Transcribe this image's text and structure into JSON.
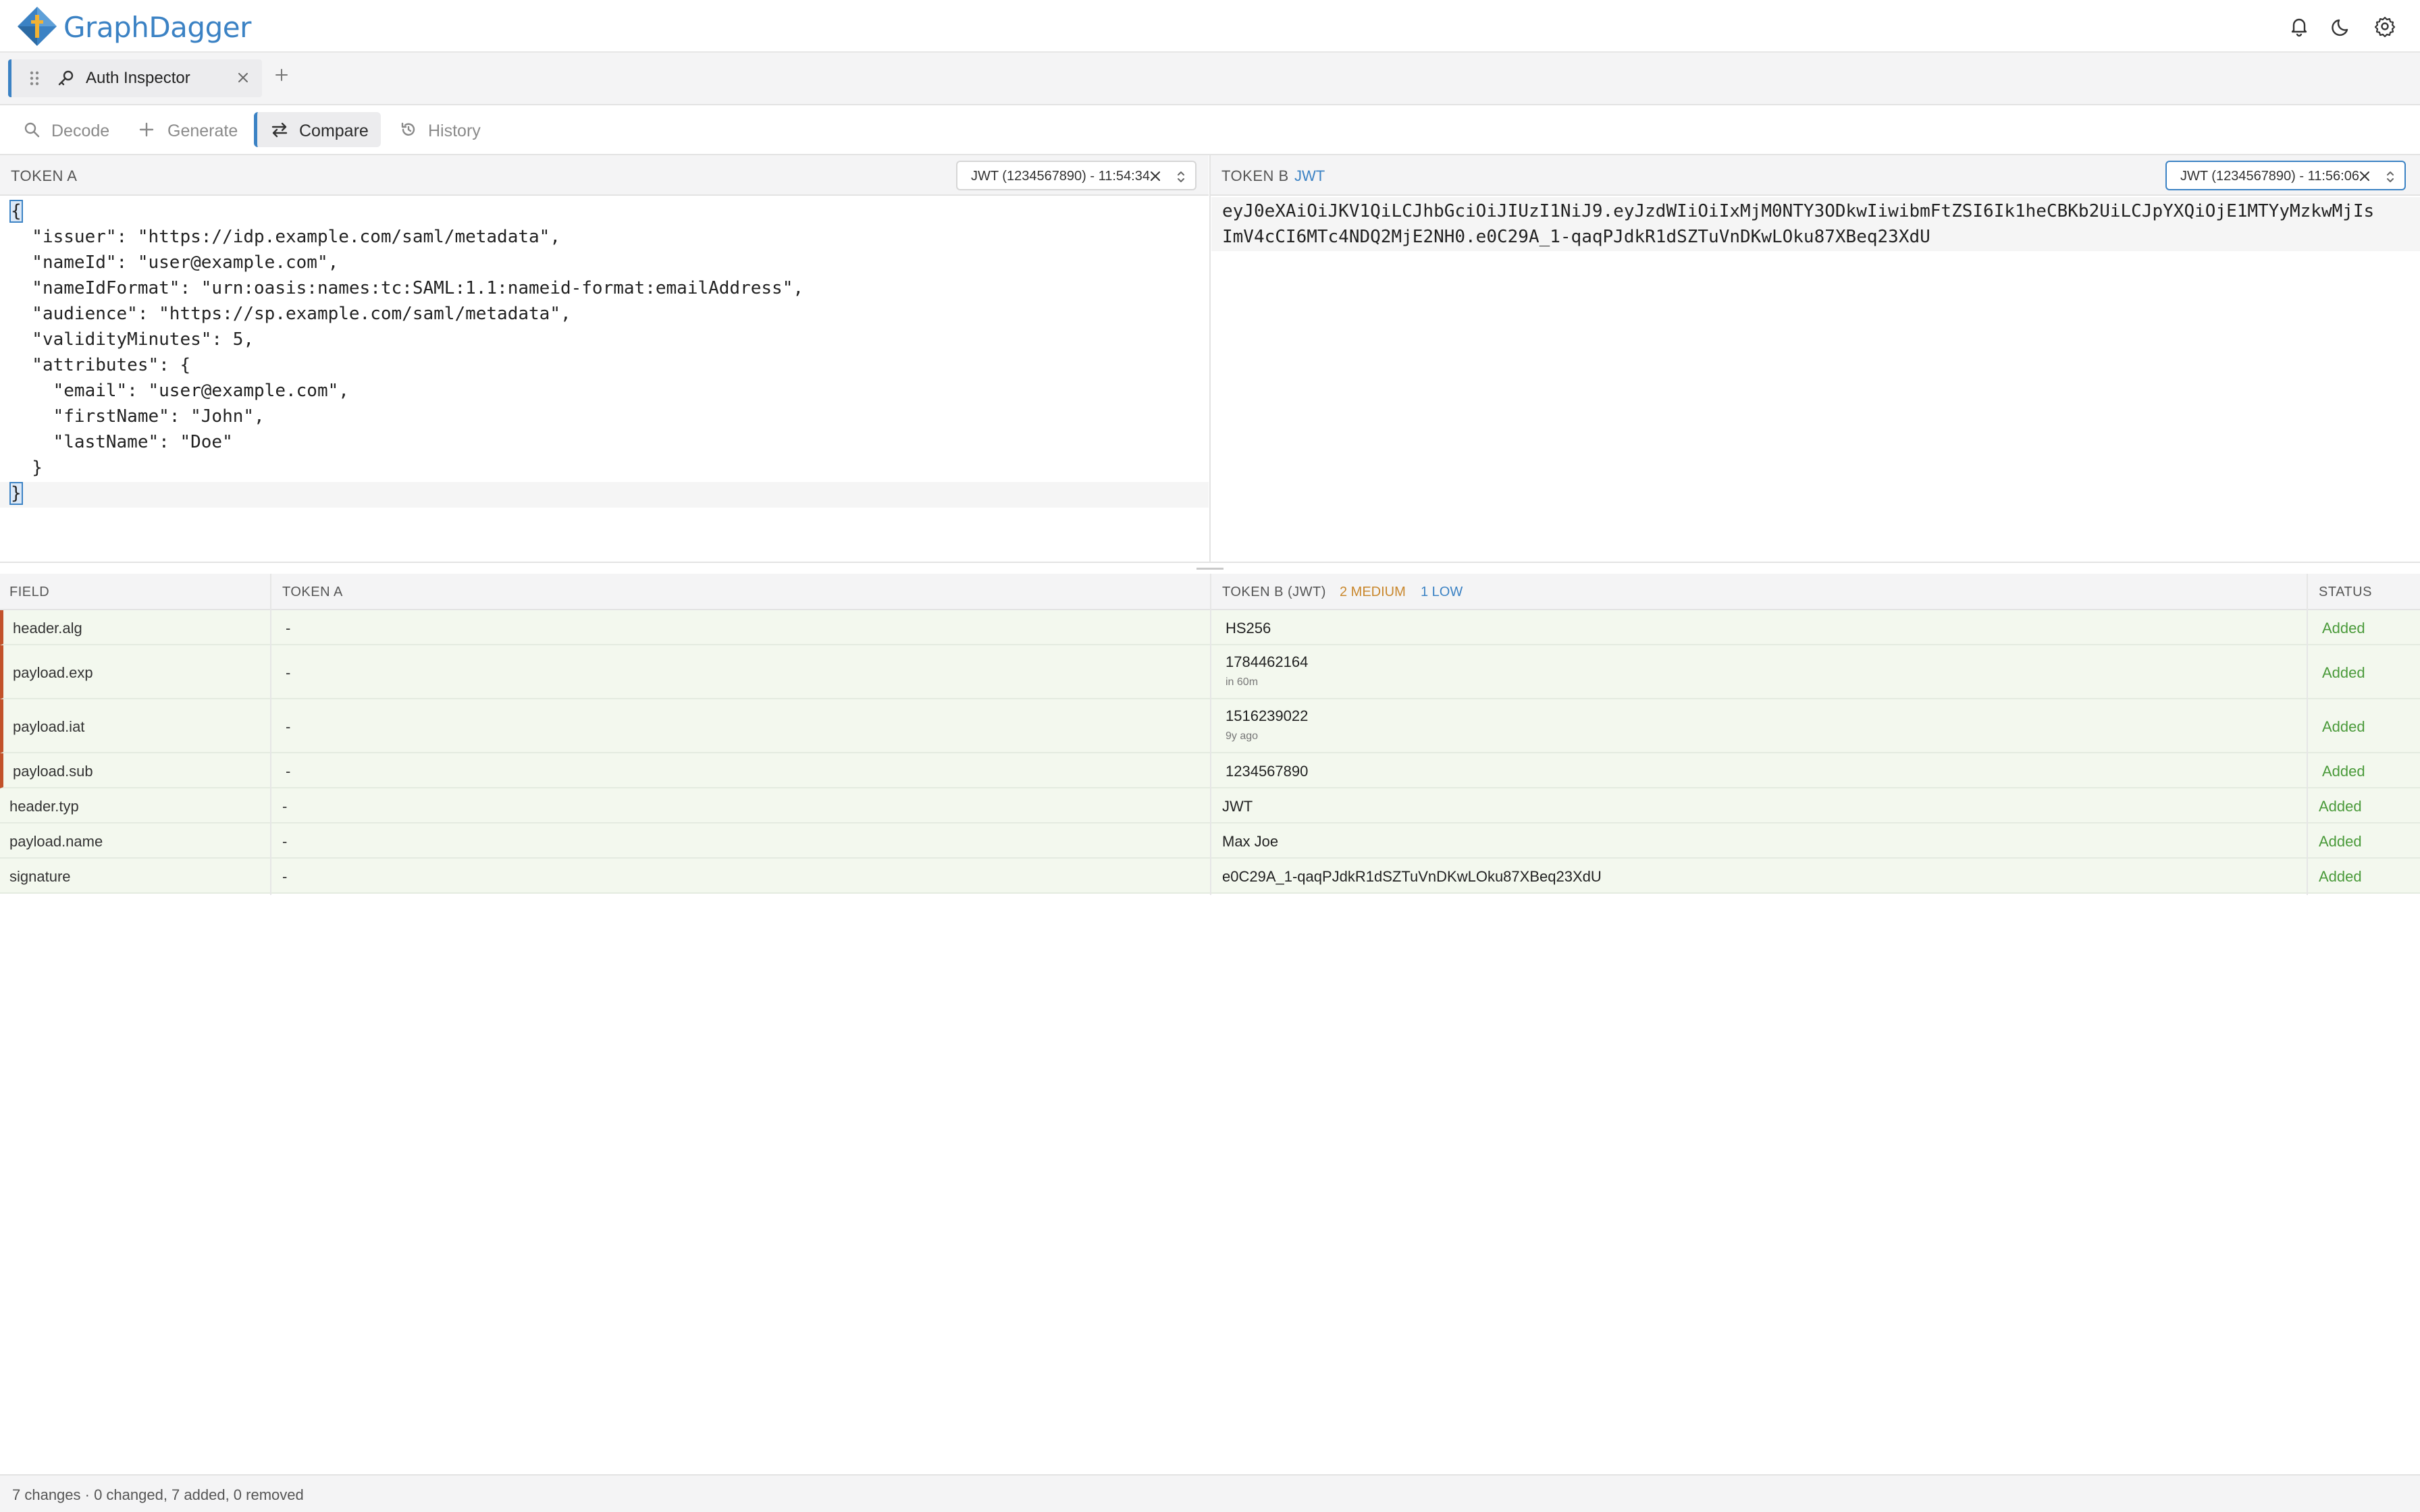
{
  "app": {
    "brand": "GraphDagger"
  },
  "tabs": [
    {
      "label": "Auth Inspector"
    }
  ],
  "subnav": [
    {
      "label": "Decode",
      "icon": "search-icon"
    },
    {
      "label": "Generate",
      "icon": "plus-icon"
    },
    {
      "label": "Compare",
      "icon": "swap-icon",
      "active": true
    },
    {
      "label": "History",
      "icon": "history-icon"
    }
  ],
  "token_a": {
    "title": "TOKEN A",
    "selector": "JWT (1234567890) - 11:54:34",
    "lines": [
      "{",
      "  \"issuer\": \"https://idp.example.com/saml/metadata\",",
      "  \"nameId\": \"user@example.com\",",
      "  \"nameIdFormat\": \"urn:oasis:names:tc:SAML:1.1:nameid-format:emailAddress\",",
      "  \"audience\": \"https://sp.example.com/saml/metadata\",",
      "  \"validityMinutes\": 5,",
      "  \"attributes\": {",
      "    \"email\": \"user@example.com\",",
      "    \"firstName\": \"John\",",
      "    \"lastName\": \"Doe\"",
      "  }",
      "}"
    ]
  },
  "token_b": {
    "title": "TOKEN B",
    "type": "JWT",
    "selector": "JWT (1234567890) - 11:56:06",
    "lines": [
      "eyJ0eXAiOiJKV1QiLCJhbGciOiJIUzI1NiJ9.eyJzdWIiOiIxMjM0NTY3ODkwIiwibmFtZSI6Ik1heCBKb2UiLCJpYXQiOjE1MTYyMzkwMjIs",
      "ImV4cCI6MTc4NDQ2MjE2NH0.e0C29A_1-qaqPJdkR1dSZTuVnDKwLOku87XBeq23XdU"
    ]
  },
  "table": {
    "headers": {
      "field": "FIELD",
      "token_a": "TOKEN A",
      "token_b": "TOKEN B (JWT)",
      "medium": "2 MEDIUM",
      "low": "1 LOW",
      "status": "STATUS"
    },
    "rows": [
      {
        "field": "header.alg",
        "a": "-",
        "b": "HS256",
        "b_sub": "",
        "status": "Added",
        "flag": true
      },
      {
        "field": "payload.exp",
        "a": "-",
        "b": "1784462164",
        "b_sub": "in 60m",
        "status": "Added",
        "flag": true
      },
      {
        "field": "payload.iat",
        "a": "-",
        "b": "1516239022",
        "b_sub": "9y ago",
        "status": "Added",
        "flag": true
      },
      {
        "field": "payload.sub",
        "a": "-",
        "b": "1234567890",
        "b_sub": "",
        "status": "Added",
        "flag": true
      },
      {
        "field": "header.typ",
        "a": "-",
        "b": "JWT",
        "b_sub": "",
        "status": "Added",
        "flag": false
      },
      {
        "field": "payload.name",
        "a": "-",
        "b": "Max Joe",
        "b_sub": "",
        "status": "Added",
        "flag": false
      },
      {
        "field": "signature",
        "a": "-",
        "b": "e0C29A_1-qaqPJdkR1dSZTuVnDKwLOku87XBeq23XdU",
        "b_sub": "",
        "status": "Added",
        "flag": false
      }
    ]
  },
  "footer": {
    "summary": "7 changes · 0 changed, 7 added, 0 removed"
  },
  "colors": {
    "accent": "#3b82c4",
    "added": "#4a9a3a",
    "flag": "#c2522a",
    "medium": "#c9872c"
  }
}
